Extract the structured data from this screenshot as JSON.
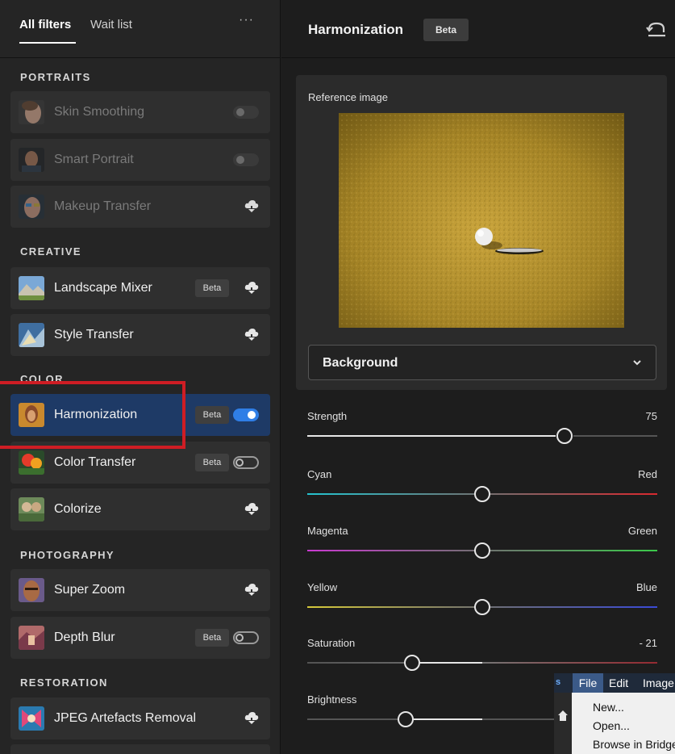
{
  "tabs": {
    "all_filters": "All filters",
    "wait_list": "Wait list",
    "more": "···"
  },
  "sections": {
    "portraits": "PORTRAITS",
    "creative": "CREATIVE",
    "color": "COLOR",
    "photography": "PHOTOGRAPHY",
    "restoration": "RESTORATION"
  },
  "filters": {
    "skin_smoothing": {
      "label": "Skin Smoothing",
      "control": "toggle-disabled"
    },
    "smart_portrait": {
      "label": "Smart Portrait",
      "control": "toggle-disabled"
    },
    "makeup_transfer": {
      "label": "Makeup Transfer",
      "control": "cloud-download"
    },
    "landscape_mixer": {
      "label": "Landscape Mixer",
      "badge": "Beta",
      "control": "cloud-download"
    },
    "style_transfer": {
      "label": "Style Transfer",
      "control": "cloud-download"
    },
    "harmonization": {
      "label": "Harmonization",
      "badge": "Beta",
      "control": "toggle-on"
    },
    "color_transfer": {
      "label": "Color Transfer",
      "badge": "Beta",
      "control": "toggle-off"
    },
    "colorize": {
      "label": "Colorize",
      "control": "cloud-download"
    },
    "super_zoom": {
      "label": "Super Zoom",
      "control": "cloud-download"
    },
    "depth_blur": {
      "label": "Depth Blur",
      "badge": "Beta",
      "control": "toggle-off"
    },
    "jpeg_artefacts": {
      "label": "JPEG Artefacts Removal",
      "control": "cloud-download"
    }
  },
  "panel": {
    "title": "Harmonization",
    "badge": "Beta",
    "reference_label": "Reference image",
    "dropdown_value": "Background"
  },
  "sliders": {
    "strength": {
      "label": "Strength",
      "value": "75"
    },
    "cyan_red": {
      "left": "Cyan",
      "right": "Red"
    },
    "magenta_green": {
      "left": "Magenta",
      "right": "Green"
    },
    "yellow_blue": {
      "left": "Yellow",
      "right": "Blue"
    },
    "saturation": {
      "label": "Saturation",
      "value": "- 21"
    },
    "brightness": {
      "label": "Brightness"
    }
  },
  "menu": {
    "app_icon": "s",
    "file": "File",
    "edit": "Edit",
    "image": "Image",
    "items": [
      "New...",
      "Open...",
      "Browse in Bridge..."
    ]
  },
  "colors": {
    "accent": "#2f7ee6",
    "selected_row": "#1e3a66",
    "highlight_box": "#cf1d24"
  }
}
